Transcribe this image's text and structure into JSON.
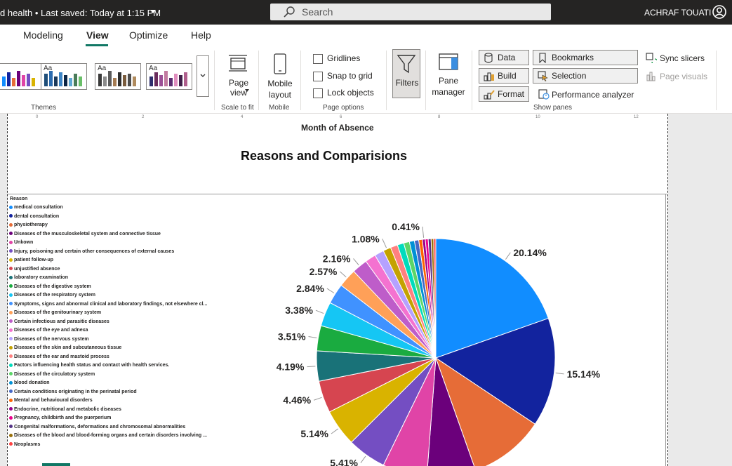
{
  "titlebar": {
    "title": "d health • Last saved: Today at 1:15 PM",
    "search_placeholder": "Search",
    "user": "ACHRAF TOUATI"
  },
  "tabs": [
    {
      "label": "Modeling",
      "active": false
    },
    {
      "label": "View",
      "active": true
    },
    {
      "label": "Optimize",
      "active": false
    },
    {
      "label": "Help",
      "active": false
    }
  ],
  "ribbon": {
    "themes_label": "Themes",
    "theme_aa": "Aa",
    "page_view": "Page view",
    "scale_to_fit": "Scale to fit",
    "mobile_layout": "Mobile layout",
    "mobile_group": "Mobile",
    "gridlines": "Gridlines",
    "snap_to_grid": "Snap to grid",
    "lock_objects": "Lock objects",
    "page_options": "Page options",
    "filters": "Filters",
    "pane_manager": "Pane manager",
    "data": "Data",
    "build": "Build",
    "format": "Format",
    "bookmarks": "Bookmarks",
    "selection": "Selection",
    "performance_analyzer": "Performance analyzer",
    "sync_slicers": "Sync slicers",
    "page_visuals": "Page visuals",
    "show_panes": "Show panes"
  },
  "canvas": {
    "axis_title": "Month of Absence",
    "ticks": [
      "0",
      "2",
      "4",
      "6",
      "8",
      "10",
      "12"
    ]
  },
  "chart_data": {
    "type": "pie",
    "title": "Reasons and Comparisions",
    "legend_title": "Reason",
    "legend_position": "left",
    "categories": [
      "medical consultation",
      "dental consultation",
      "physiotherapy",
      "Diseases of the musculoskeletal system and connective tissue",
      "Unkown",
      "Injury, poisoning and certain other consequences of external causes",
      "patient follow-up",
      "unjustified absence",
      "laboratory examination",
      "Diseases of the digestive system",
      "Diseases of the respiratory system",
      "Symptoms, signs and abnormal clinical and laboratory findings, not elsewhere cl...",
      "Diseases of the genitourinary system",
      "Certain infectious and parasitic diseases",
      "Diseases of the eye and adnexa",
      "Diseases of the nervous system",
      "Diseases of the skin and subcutaneous tissue",
      "Diseases of the ear and mastoid process",
      "Factors influencing health status and contact with health services.",
      "Diseases of the circulatory system",
      "blood donation",
      "Certain conditions originating in the perinatal period",
      "Mental and behavioural disorders",
      "Endocrine, nutritional and metabolic diseases",
      "Pregnancy, childbirth and the puerperium",
      "Congenital malformations, deformations and chromosomal abnormalities",
      "Diseases of the blood and blood-forming organs and certain disorders involving ...",
      "Neoplasms"
    ],
    "values": [
      20.14,
      15.14,
      10.5,
      6.8,
      6.2,
      5.41,
      5.14,
      4.46,
      4.19,
      3.51,
      3.38,
      2.84,
      2.57,
      2.16,
      1.5,
      1.3,
      1.08,
      1.0,
      0.9,
      0.8,
      0.7,
      0.6,
      0.5,
      0.41,
      0.4,
      0.4,
      0.35,
      0.3
    ],
    "labels": [
      "20.14%",
      "15.14%",
      "",
      "",
      "",
      "5.41%",
      "5.14%",
      "4.46%",
      "4.19%",
      "3.51%",
      "3.38%",
      "2.84%",
      "2.57%",
      "2.16%",
      "",
      "",
      "1.08%",
      "",
      "",
      "",
      "",
      "",
      "",
      "0.41%",
      "",
      "",
      "",
      ""
    ],
    "colors": [
      "#118DFF",
      "#12239E",
      "#E66C37",
      "#6B007B",
      "#E044A7",
      "#744EC2",
      "#D9B300",
      "#D64550",
      "#197278",
      "#1AAB40",
      "#15C6F4",
      "#4092FF",
      "#FFA058",
      "#BE5DC9",
      "#F472D0",
      "#B5A1FF",
      "#C4A200",
      "#FF8080",
      "#00DBBC",
      "#5BD667",
      "#0091D5",
      "#4668C5",
      "#FF6300",
      "#99008A",
      "#EC008C",
      "#533285",
      "#99700A",
      "#FF4141"
    ]
  }
}
